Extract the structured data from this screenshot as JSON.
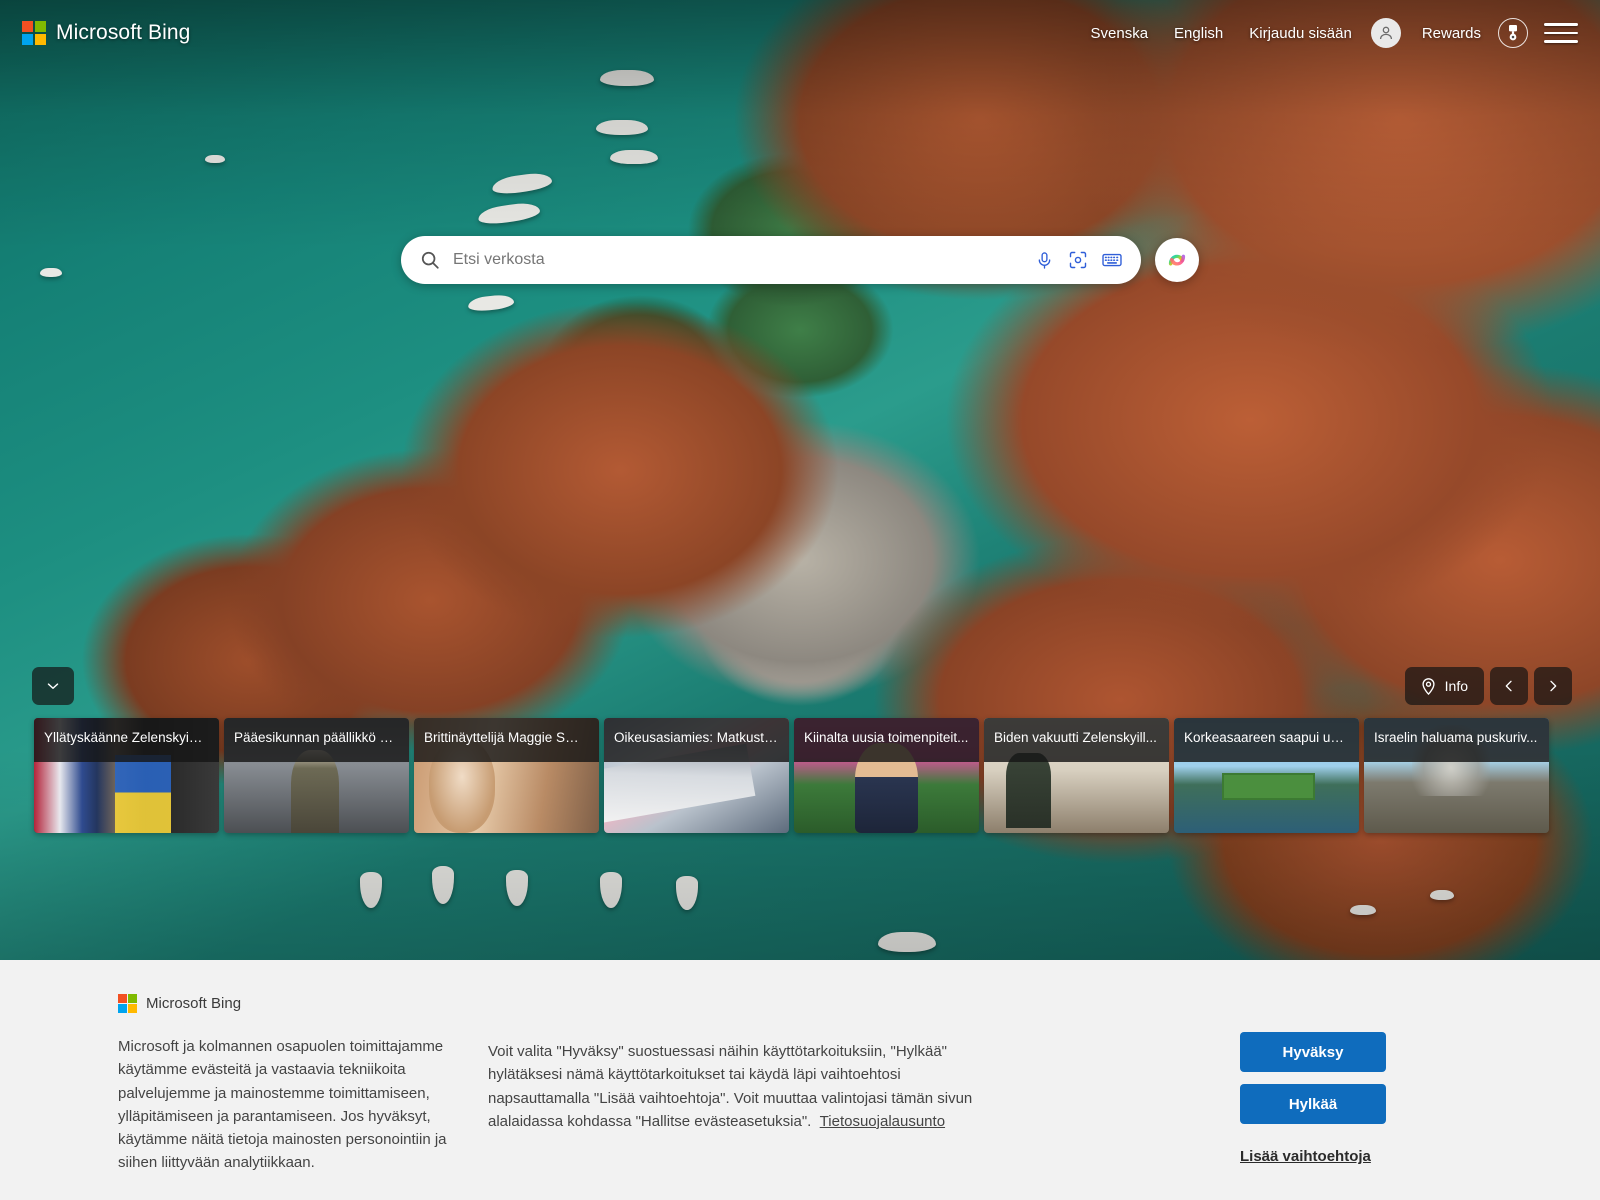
{
  "header": {
    "brand": "Microsoft Bing",
    "logo_icon": "microsoft-logo-icon",
    "links": [
      {
        "label": "Svenska",
        "name": "lang-svenska"
      },
      {
        "label": "English",
        "name": "lang-english"
      },
      {
        "label": "Kirjaudu sisään",
        "name": "sign-in"
      }
    ],
    "avatar_icon": "person-avatar-icon",
    "rewards_label": "Rewards",
    "rewards_icon": "medal-badge-icon",
    "menu_icon": "hamburger-menu-icon"
  },
  "search": {
    "placeholder": "Etsi verkosta",
    "value": "",
    "search_icon": "search-icon",
    "mic_icon": "microphone-icon",
    "visual_icon": "visual-search-camera-icon",
    "keyboard_icon": "keyboard-icon",
    "copilot_icon": "copilot-icon"
  },
  "hero": {
    "scroll_down_icon": "chevron-down-icon",
    "info_label": "Info",
    "info_icon": "location-pin-icon",
    "prev_icon": "chevron-left-icon",
    "next_icon": "chevron-right-icon"
  },
  "news": {
    "cards": [
      {
        "title": "Yllätyskäänne Zelenskyin ...",
        "art": "t-zelensky"
      },
      {
        "title": "Pääesikunnan päällikkö vi...",
        "art": "t-military"
      },
      {
        "title": "Brittinäyttelijä Maggie Smi...",
        "art": "t-maggie"
      },
      {
        "title": "Oikeusasiamies: Matkusta...",
        "art": "t-ship"
      },
      {
        "title": "Kiinalta uusia toimenpiteit...",
        "art": "t-xi"
      },
      {
        "title": "Biden vakuutti Zelenskyill...",
        "art": "t-biden"
      },
      {
        "title": "Korkeasaareen saapui uu...",
        "art": "t-korkeasaari"
      },
      {
        "title": "Israelin haluama puskuriv...",
        "art": "t-israel"
      }
    ]
  },
  "cookie": {
    "brand": "Microsoft Bing",
    "paragraph_1": "Microsoft ja kolmannen osapuolen toimittajamme käytämme evästeitä ja vastaavia tekniikoita palvelujemme ja mainostemme toimittamiseen, ylläpitämiseen ja parantamiseen. Jos hyväksyt, käytämme näitä tietoja mainosten personointiin ja siihen liittyvään analytiikkaan.",
    "paragraph_2": "Voit valita \"Hyväksy\" suostuessasi näihin käyttötarkoituksiin, \"Hylkää\" hylätäksesi nämä käyttötarkoitukset tai käydä läpi vaihtoehtosi napsauttamalla \"Lisää vaihtoehtoja\". Voit muuttaa valintojasi tämän sivun alalaidassa kohdassa \"Hallitse evästeasetuksia\".",
    "privacy_link": "Tietosuojalausunto",
    "accept_label": "Hyväksy",
    "reject_label": "Hylkää",
    "more_options_label": "Lisää vaihtoehtoja"
  },
  "colors": {
    "accent_blue": "#0f6cbd",
    "search_icon_blue": "#2f5ed8",
    "banner_bg": "#f2f2f2"
  }
}
